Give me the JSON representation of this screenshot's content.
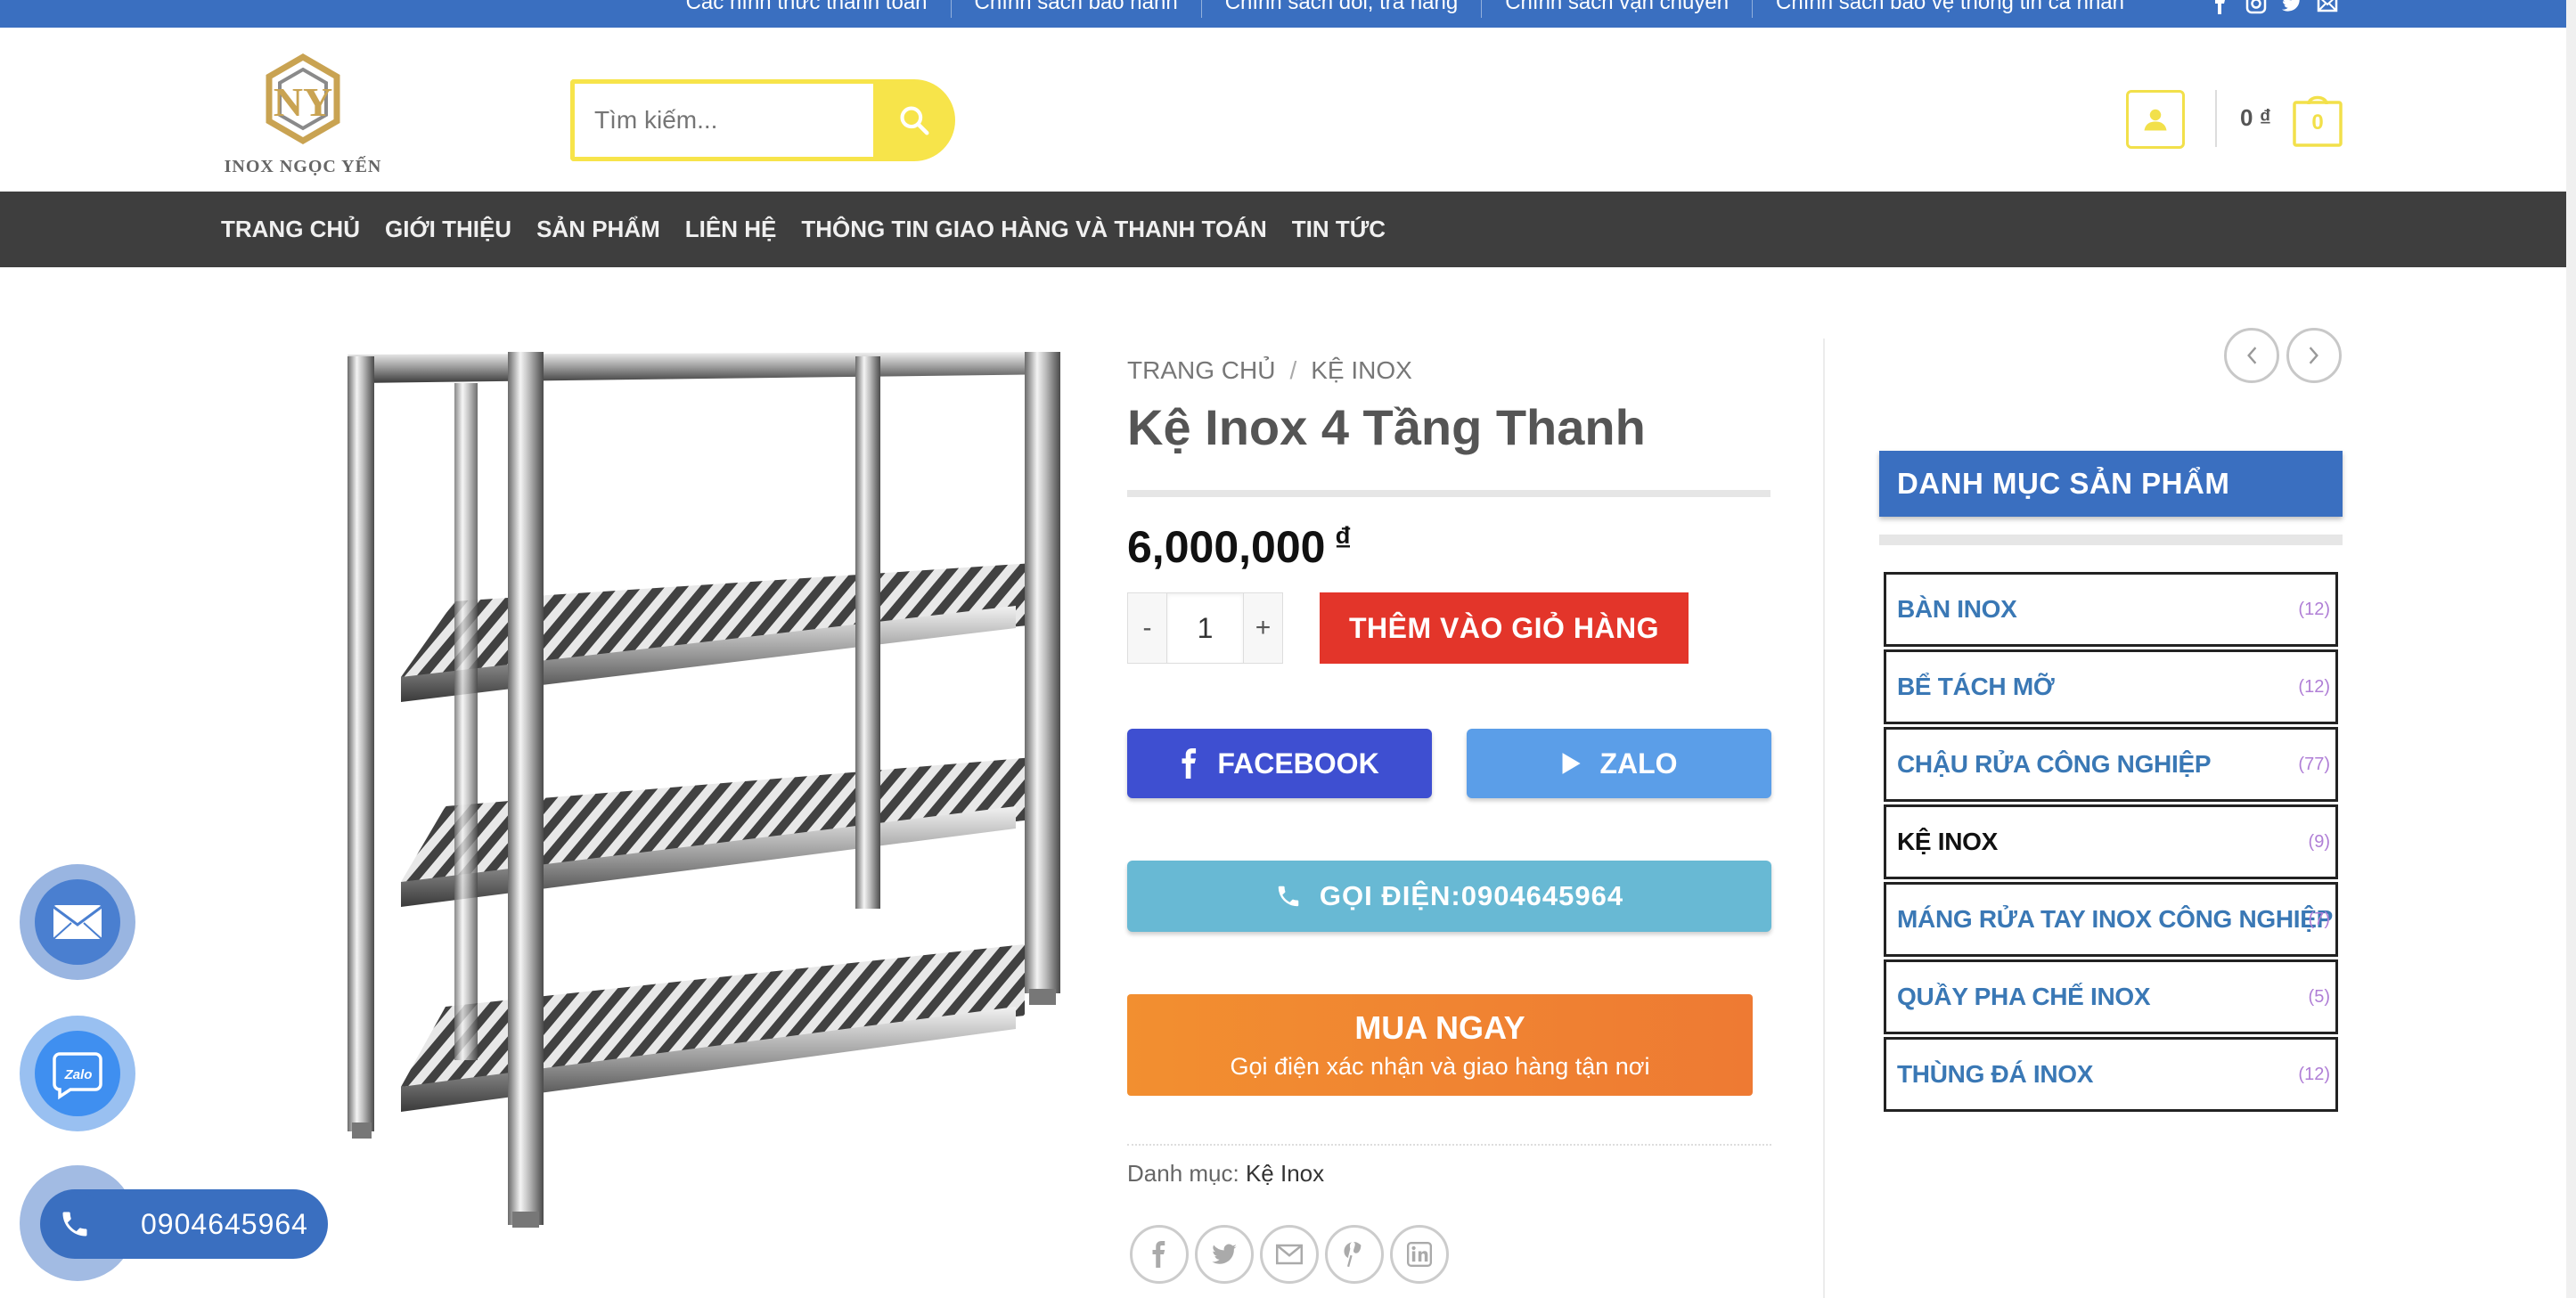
{
  "topbar": {
    "links": [
      "Các hình thức thanh toán",
      "Chính sách bảo hành",
      "Chính sách đổi, trả hàng",
      "Chính sách vận chuyển",
      "Chính sách bảo vệ thông tin cá nhân"
    ],
    "social_icons": [
      "facebook-icon",
      "instagram-icon",
      "twitter-icon",
      "email-icon"
    ],
    "color": "#3a6fc0"
  },
  "header": {
    "logo_text": "INOX NGỌC YẾN",
    "search_placeholder": "Tìm kiếm...",
    "cart_total": "0 ₫",
    "cart_count": "0",
    "accent_color": "#f7e44a"
  },
  "nav": {
    "items": [
      "TRANG CHỦ",
      "GIỚI THIỆU",
      "SẢN PHẨM",
      "LIÊN HỆ",
      "THÔNG TIN GIAO HÀNG VÀ THANH TOÁN",
      "TIN TỨC"
    ]
  },
  "product": {
    "breadcrumb": [
      "TRANG CHỦ",
      "KỆ INOX"
    ],
    "breadcrumb_sep": "/",
    "title": "Kệ Inox 4 Tầng Thanh",
    "price": "6,000,000",
    "currency": "₫",
    "qty_minus": "-",
    "qty_value": "1",
    "qty_plus": "+",
    "add_to_cart": "THÊM VÀO GIỎ HÀNG",
    "facebook_label": "FACEBOOK",
    "zalo_label": "ZALO",
    "call_label": "GỌI ĐIỆN:0904645964",
    "buy_now_title": "MUA NGAY",
    "buy_now_sub": "Gọi điện xác nhận và giao hàng tận nơi",
    "category_label": "Danh mục:",
    "category_link": "Kệ Inox",
    "share_icons": [
      "facebook-icon",
      "twitter-icon",
      "email-icon",
      "pinterest-icon",
      "linkedin-icon"
    ]
  },
  "sidebar": {
    "title": "DANH MỤC SẢN PHẨM",
    "categories": [
      {
        "name": "BÀN INOX",
        "count": "(12)",
        "active": false
      },
      {
        "name": "BỂ TÁCH MỠ",
        "count": "(12)",
        "active": false
      },
      {
        "name": "CHẬU RỬA CÔNG NGHIỆP",
        "count": "(77)",
        "active": false
      },
      {
        "name": "KỆ INOX",
        "count": "(9)",
        "active": true
      },
      {
        "name": "MÁNG RỬA TAY INOX CÔNG NGHIỆP",
        "count": "(7)",
        "active": false
      },
      {
        "name": "QUẦY PHA CHẾ INOX",
        "count": "(5)",
        "active": false
      },
      {
        "name": "THÙNG ĐÁ INOX",
        "count": "(12)",
        "active": false
      }
    ]
  },
  "floating": {
    "phone_number": "0904645964",
    "zalo_badge": "Zalo"
  }
}
